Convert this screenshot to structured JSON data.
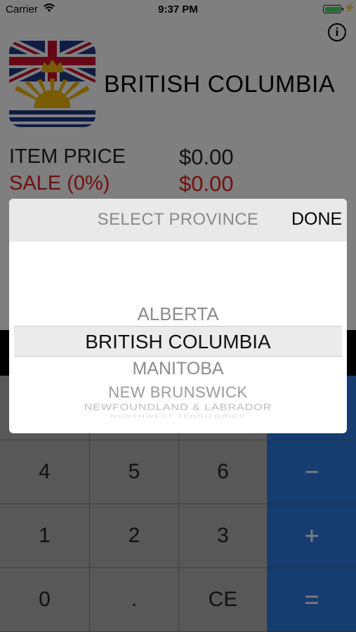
{
  "status_bar": {
    "carrier": "Carrier",
    "time": "9:37 PM"
  },
  "header": {
    "province": "BRITISH COLUMBIA"
  },
  "summary": {
    "item_price_label": "ITEM PRICE",
    "item_price_value": "$0.00",
    "sale_label": "SALE (0%)",
    "sale_value": "$0.00"
  },
  "keypad": {
    "row4": {
      "k1": "4",
      "k2": "5",
      "k3": "6",
      "op": "−"
    },
    "row3": {
      "k1": "1",
      "k2": "2",
      "k3": "3",
      "op": "+"
    },
    "row0": {
      "k1": "0",
      "k2": ".",
      "k3": "CE",
      "op": "="
    }
  },
  "picker": {
    "title": "SELECT PROVINCE",
    "done_label": "DONE",
    "options": [
      "ALBERTA",
      "BRITISH COLUMBIA",
      "MANITOBA",
      "NEW BRUNSWICK",
      "NEWFOUNDLAND & LABRADOR",
      "NORTHWEST TERRITORIES"
    ],
    "selected": "BRITISH COLUMBIA"
  },
  "colors": {
    "accent_blue": "#2d7be0",
    "sale_red": "#e02020",
    "battery_green": "#4cd964"
  }
}
